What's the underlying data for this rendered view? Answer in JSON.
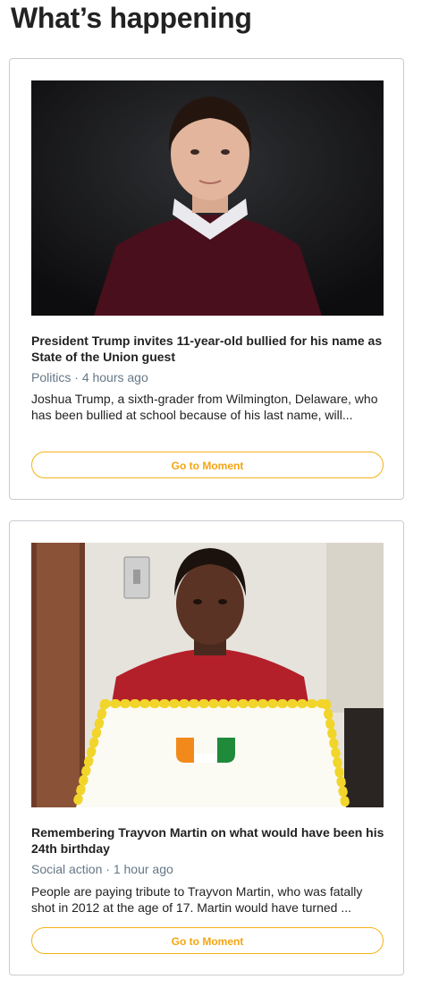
{
  "section": {
    "title": "What’s happening"
  },
  "moments": [
    {
      "headline": "President Trump invites 11-year-old bullied for his name as State of the Union guest",
      "category": "Politics",
      "separator": "·",
      "time": "4 hours ago",
      "description": "Joshua Trump, a sixth-grader from Wilmington, Delaware, who has been bullied at school because of his last name, will...",
      "button_label": "Go to Moment",
      "image": "boy-portrait-photo"
    },
    {
      "headline": "Remembering Trayvon Martin on what would have been his 24th birthday",
      "category": "Social action",
      "separator": "·",
      "time": "1 hour ago",
      "description": "People are paying tribute to Trayvon Martin, who was fatally shot in 2012 at the age of 17. Martin would have turned ...",
      "button_label": "Go to Moment",
      "image": "birthday-cake-photo"
    }
  ],
  "colors": {
    "accent": "#f5a511",
    "border": "#c9ccd0",
    "meta": "#657786"
  }
}
